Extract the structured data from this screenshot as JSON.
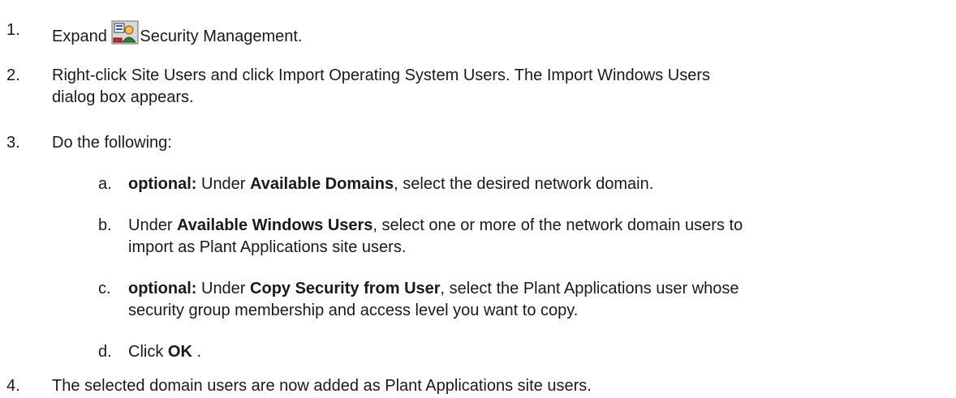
{
  "steps": [
    {
      "num": "1.",
      "parts": {
        "before": "Expand ",
        "icon": "security-management-icon",
        "after": "Security Management."
      }
    },
    {
      "num": "2.",
      "line1": "Right-click Site Users and click Import Operating System Users. The Import Windows Users",
      "line2": "dialog box appears."
    },
    {
      "num": "3.",
      "text": "Do the following:"
    },
    {
      "num": "4.",
      "text": "The selected domain users are now added as Plant Applications site users."
    }
  ],
  "substeps": [
    {
      "letter": "a.",
      "b1": "optional:",
      "t1": " Under ",
      "b2": "Available Domains",
      "t2": ", select the desired network domain."
    },
    {
      "letter": "b.",
      "t0": "Under ",
      "b1": "Available Windows Users",
      "t1": ", select one or more of the network domain users to",
      "line2": "import as Plant Applications site users."
    },
    {
      "letter": "c.",
      "b1": "optional:",
      "t1": " Under ",
      "b2": "Copy Security from User",
      "t2": ", select the Plant Applications user whose",
      "line2": "security group membership and access level you want to copy."
    },
    {
      "letter": "d.",
      "t0": "Click ",
      "b1": "OK",
      "t1": " ."
    }
  ]
}
